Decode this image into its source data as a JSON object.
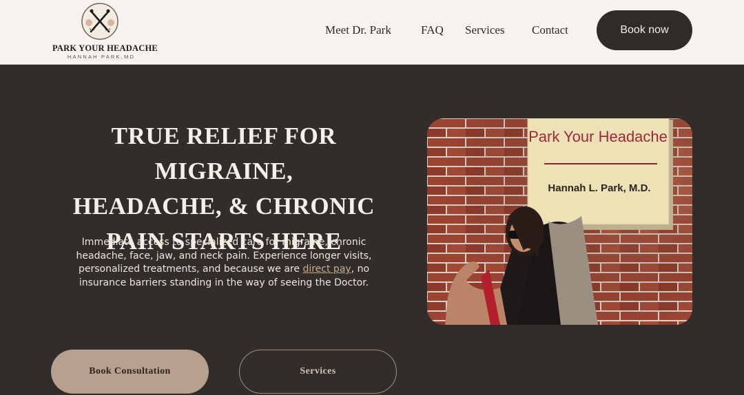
{
  "header": {
    "logo": {
      "title": "PARK YOUR HEADACHE",
      "subtitle": "HANNAH PARK,MD"
    },
    "nav": [
      {
        "label": "Meet Dr. Park"
      },
      {
        "label": "FAQ"
      },
      {
        "label": "Services"
      },
      {
        "label": "Contact"
      }
    ],
    "book_now_label": "Book now"
  },
  "hero": {
    "title_lines": [
      "TRUE RELIEF FOR MIGRAINE,",
      "HEADACHE, & CHRONIC",
      "PAIN STARTS HERE"
    ],
    "body_before_link": "Immediate access to specialized care for migraine, chronic headache, face, jaw, and neck pain. Experience longer visits, personalized treatments, and because we are ",
    "body_link": "direct pay",
    "body_after_link": ", no insurance barriers standing in the way of seeing the Doctor.",
    "photo": {
      "sign_title": "Park Your Headache",
      "sign_name": "Hannah L. Park, M.D."
    }
  },
  "cta": {
    "primary_label": "Book Consultation",
    "secondary_label": "Services"
  },
  "colors": {
    "page_bg": "#332d2a",
    "header_bg": "#f6f3ee",
    "accent": "#b7a08d",
    "link": "#c7ab93"
  }
}
